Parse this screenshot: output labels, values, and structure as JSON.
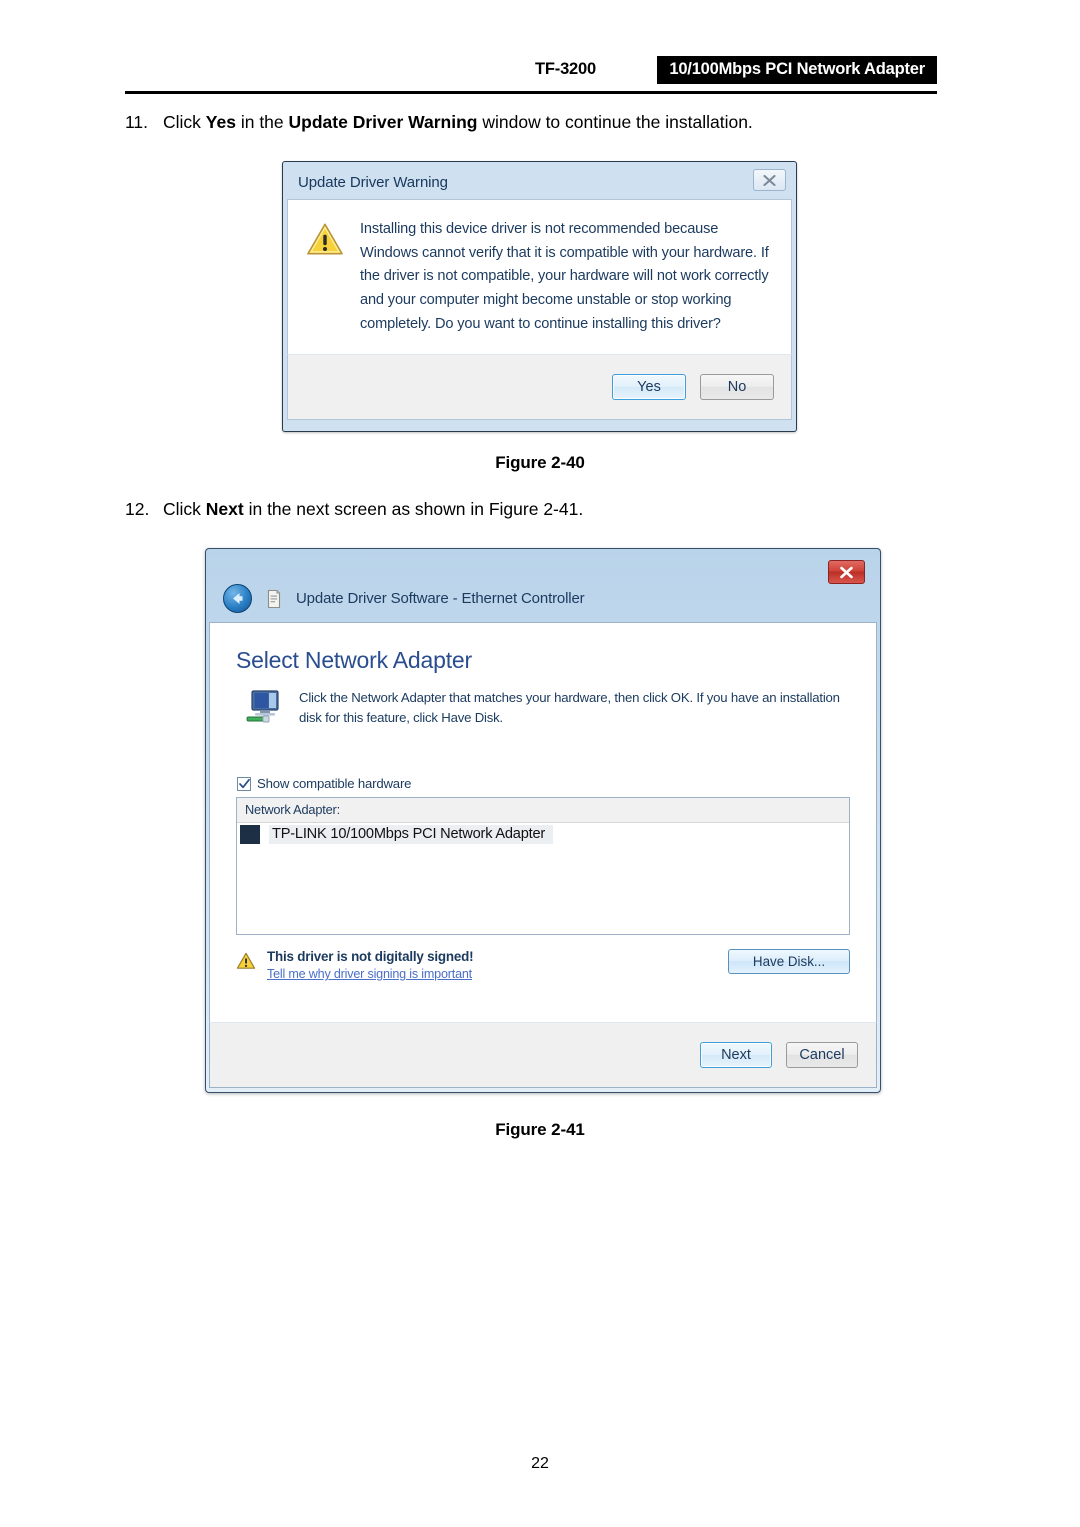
{
  "header": {
    "model": "TF-3200",
    "banner": "10/100Mbps PCI Network Adapter"
  },
  "steps": {
    "step11": {
      "number": "11.",
      "part1": "Click ",
      "bold1": "Yes",
      "part2": " in the ",
      "bold2": "Update Driver Warning",
      "part3": " window to continue the installation."
    },
    "step12": {
      "number": "12.",
      "part1": "Click ",
      "bold1": "Next",
      "part2": " in the next screen as shown in Figure 2-41."
    }
  },
  "captions": {
    "figure_2_40": "Figure 2-40",
    "figure_2_41": "Figure 2-41"
  },
  "page_number": "22",
  "dialog_warning": {
    "title": "Update Driver Warning",
    "close_glyph": "✕",
    "message": "Installing this device driver is not recommended because Windows cannot verify that it is compatible with your hardware. If the driver is not compatible, your hardware will not work correctly and your computer might become unstable or stop working completely.  Do you want to continue installing this driver?",
    "buttons": {
      "yes": "Yes",
      "no": "No"
    }
  },
  "dialog_update_driver": {
    "window_title": "Update Driver Software - Ethernet Controller",
    "page_title": "Select Network Adapter",
    "instruction": "Click the Network Adapter that matches your hardware, then click OK. If you have an installation disk for this feature, click Have Disk.",
    "checkbox": {
      "label": "Show compatible hardware",
      "checked": true
    },
    "list": {
      "column_header": "Network Adapter:",
      "items": [
        {
          "label": "TP-LINK 10/100Mbps PCI Network Adapter",
          "selected": true
        }
      ]
    },
    "signing": {
      "warning": "This driver is not digitally signed!",
      "link": "Tell me why driver signing is important"
    },
    "buttons": {
      "have_disk": "Have Disk...",
      "next": "Next",
      "cancel": "Cancel"
    }
  },
  "colors": {
    "banner_bg": "#000000",
    "dialog_title_text": "#17385c",
    "page_title_blue": "#2a4d8f",
    "link_blue": "#4a6fc9",
    "close_red": "#cf4238",
    "warning_yellow": "#f5c518",
    "selection_gray": "#eceff1"
  }
}
